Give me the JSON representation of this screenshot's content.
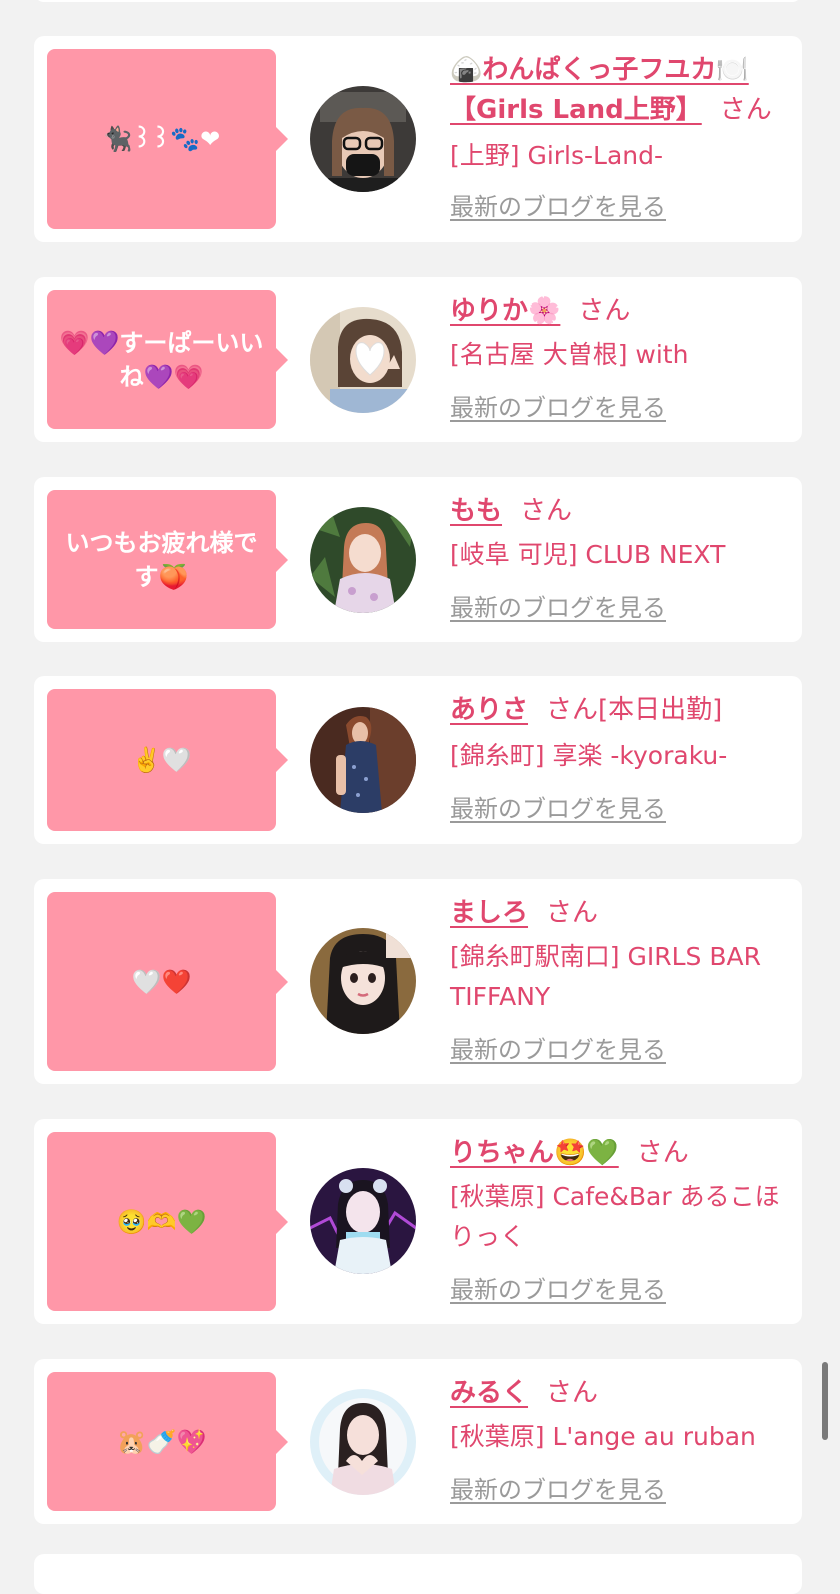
{
  "entries": [
    {
      "message": "🐈‍⬛꒱꒱🐾❤",
      "name": "🍙わんぱくっ子フユカ🍽️【Girls Land上野】",
      "suffix": "さん",
      "badge": "",
      "shop": "[上野] Girls-Land-",
      "blog_link": "最新のブログを見る"
    },
    {
      "message": "💗💜すーぱーいいね💜💗",
      "name": "ゆりか🌸",
      "suffix": "さん",
      "badge": "",
      "shop": "[名古屋 大曽根] with",
      "blog_link": "最新のブログを見る"
    },
    {
      "message": "いつもお疲れ様です🍑",
      "name": "もも",
      "suffix": "さん",
      "badge": "",
      "shop": "[岐阜 可児] CLUB NEXT",
      "blog_link": "最新のブログを見る"
    },
    {
      "message": "✌️🤍",
      "name": "ありさ",
      "suffix": "さん",
      "badge": "[本日出勤]",
      "shop": "[錦糸町] 享楽 -kyoraku-",
      "blog_link": "最新のブログを見る"
    },
    {
      "message": "🤍❤️",
      "name": "ましろ",
      "suffix": "さん",
      "badge": "",
      "shop": "[錦糸町駅南口] GIRLS BAR TIFFANY",
      "blog_link": "最新のブログを見る"
    },
    {
      "message": "🥹🫶💚",
      "name": "りちゃん🤩💚",
      "suffix": "さん",
      "badge": "",
      "shop": "[秋葉原] Cafe&Bar あるこほりっく",
      "blog_link": "最新のブログを見る"
    },
    {
      "message": "🐹🍼💖",
      "name": "みるく",
      "suffix": "さん",
      "badge": "",
      "shop": "[秋葉原] L'ange au ruban",
      "blog_link": "最新のブログを見る"
    }
  ],
  "colors": {
    "bubble": "#ff97a8",
    "accent": "#e0476e",
    "link_gray": "#9a9a9a",
    "background": "#f2f2f2"
  }
}
